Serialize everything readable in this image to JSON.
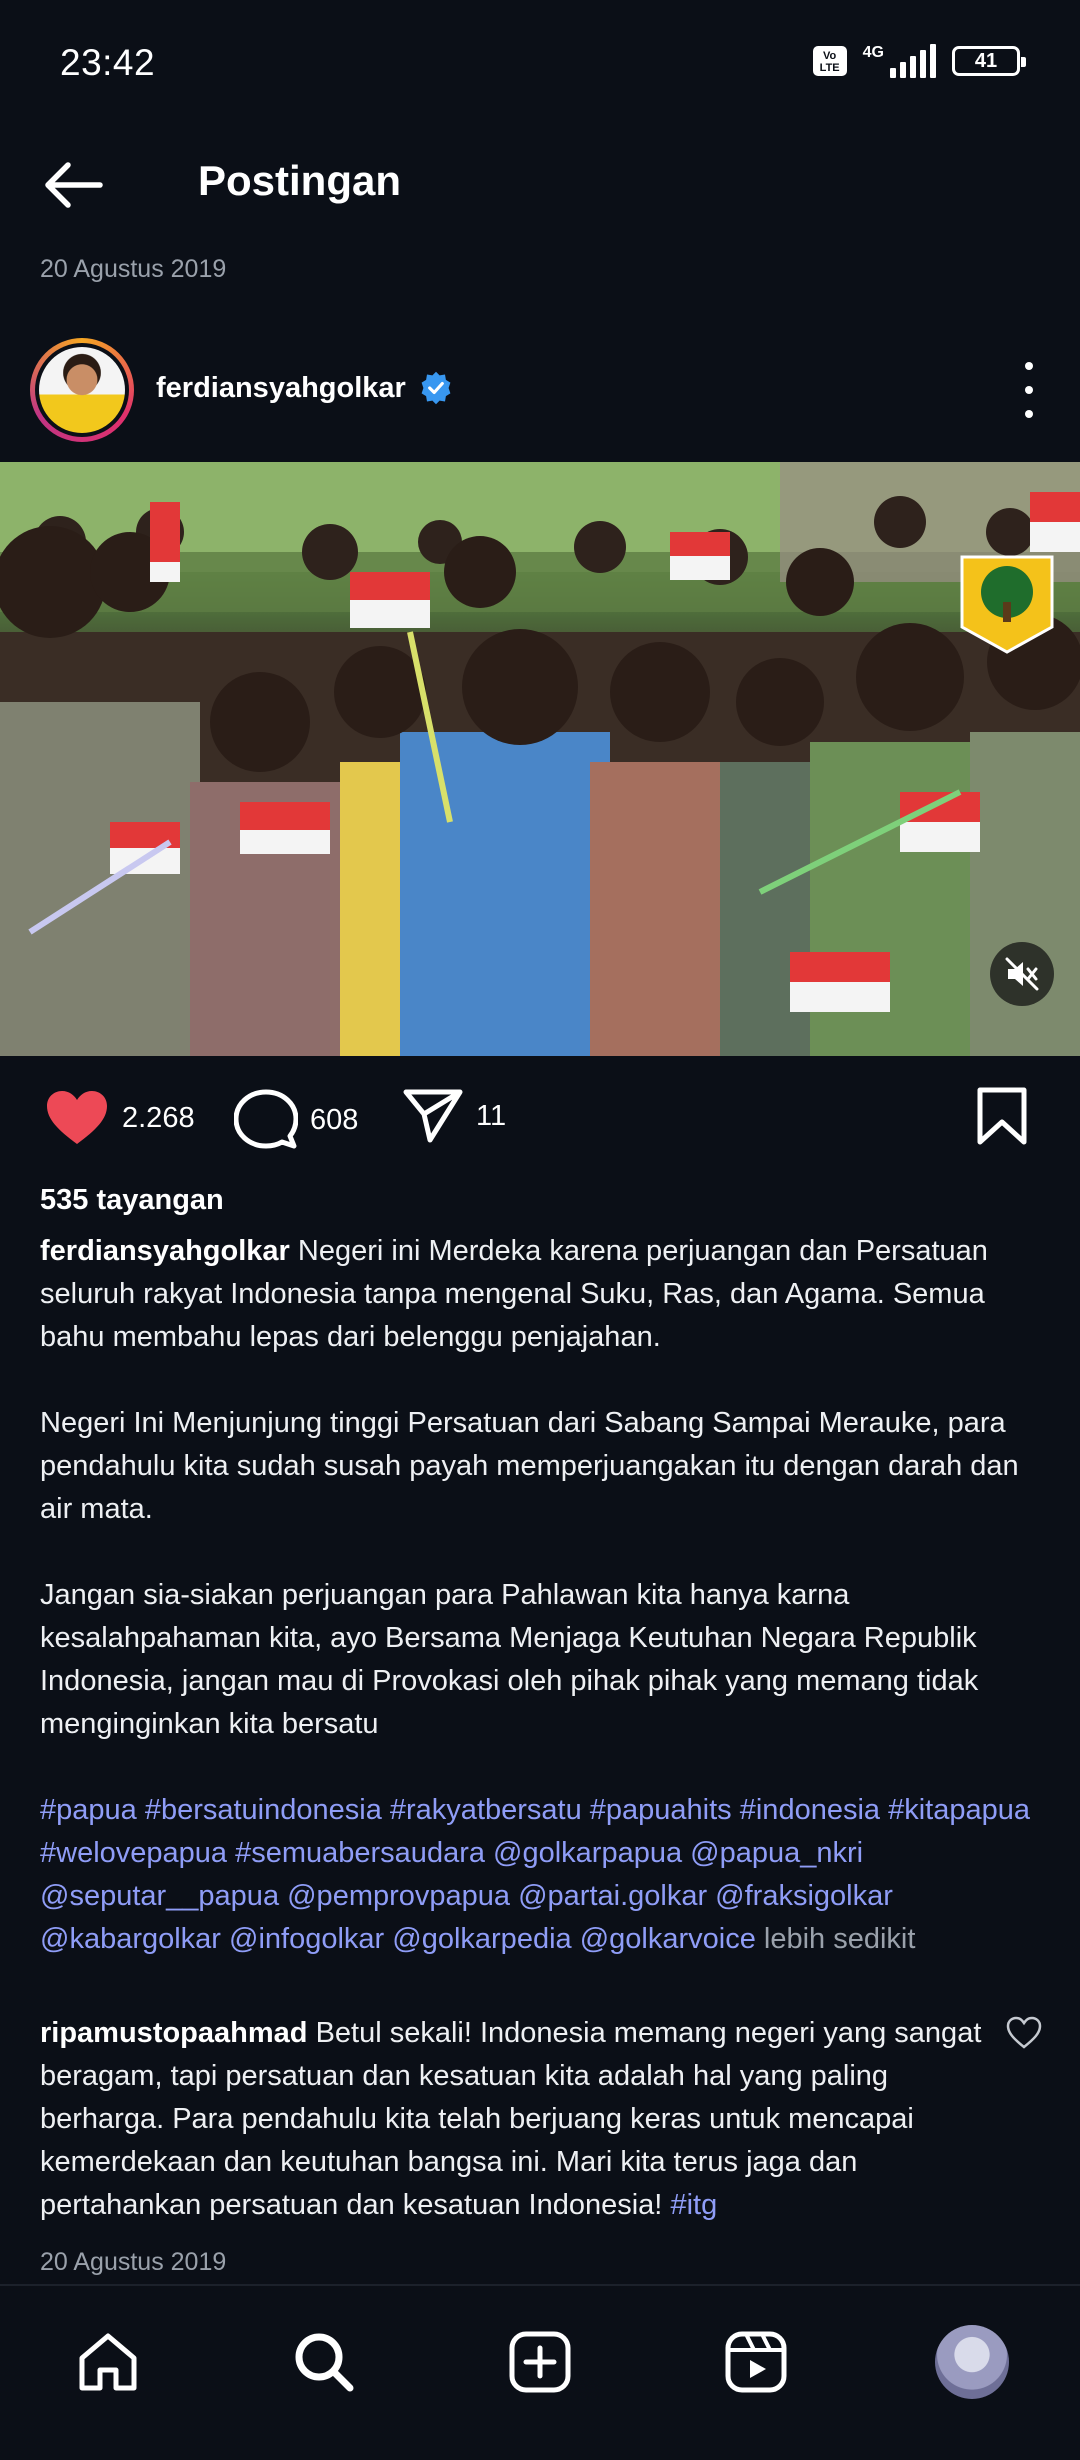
{
  "status_bar": {
    "time": "23:42",
    "volte": "Vo LTE",
    "network": "4G",
    "battery": "41"
  },
  "header": {
    "title": "Postingan",
    "date": "20 Agustus 2019"
  },
  "post": {
    "username": "ferdiansyahgolkar",
    "verified": true,
    "likes": "2.268",
    "comments": "608",
    "shares": "11",
    "views": "535 tayangan",
    "caption_user": "ferdiansyahgolkar",
    "caption_p1": "Negeri ini Merdeka karena perjuangan dan Persatuan seluruh rakyat Indonesia tanpa mengenal Suku, Ras, dan Agama. Semua bahu membahu lepas dari belenggu penjajahan.",
    "caption_p2": "Negeri Ini Menjunjung tinggi Persatuan dari Sabang Sampai Merauke, para pendahulu kita sudah susah payah memperjuangakan itu dengan darah dan air mata.",
    "caption_p3": "Jangan sia-siakan perjuangan para Pahlawan kita hanya karna kesalahpahaman kita, ayo Bersama Menjaga Keutuhan Negara Republik Indonesia, jangan mau di Provokasi oleh pihak pihak yang memang tidak menginginkan kita bersatu",
    "hashtags": "#papua #bersatuindonesia #rakyatbersatu #papuahits #indonesia #kitapapua #welovepapua #semuabersaudara @golkarpapua @papua_nkri @seputar__papua @pemprovpapua @partai.golkar @fraksigolkar @kabargolkar @infogolkar @golkarpedia @golkarvoice",
    "less_label": "lebih sedikit"
  },
  "comment": {
    "user": "ripamustopaahmad",
    "text": "Betul sekali! Indonesia memang negeri yang sangat beragam, tapi persatuan dan kesatuan kita adalah hal yang paling berharga. Para pendahulu kita telah berjuang keras untuk mencapai kemerdekaan dan keutuhan bangsa ini. Mari kita terus jaga dan pertahankan persatuan dan kesatuan Indonesia!",
    "tag": "#itg",
    "date": "20 Agustus 2019"
  },
  "colors": {
    "background": "#0b0f17",
    "link": "#8f9df7",
    "like": "#ed4956",
    "verified": "#3897f0",
    "muted_text": "#9aa1ab"
  },
  "icons": {
    "back": "arrow-left-icon",
    "verified": "verified-badge-icon",
    "more": "more-vertical-icon",
    "like": "heart-filled-icon",
    "comment": "comment-bubble-icon",
    "share": "paper-plane-icon",
    "bookmark": "bookmark-icon",
    "mute": "speaker-muted-icon",
    "nav": [
      "home-icon",
      "search-icon",
      "add-post-icon",
      "reels-icon",
      "profile-avatar"
    ]
  }
}
